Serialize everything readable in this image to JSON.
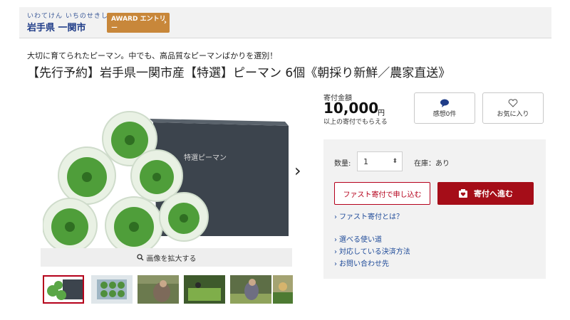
{
  "header": {
    "kana": "いわてけん いちのせきし",
    "city": "岩手県 一関市",
    "award_label": "AWARD エントリー",
    "award_chevron": "›",
    "award_color": "#c8873a"
  },
  "product": {
    "subtitle": "大切に育てられたピーマン。中でも、高品質なピーマンばかりを選別！",
    "title": "【先行予約】岩手県一関市産【特選】ピーマン 6個《朝採り新鮮／農家直送》",
    "box_label": "特選ピーマン",
    "zoom_label": "画像を拡大する",
    "next_arrow": "›"
  },
  "price": {
    "label": "寄付金額",
    "amount": "10,000",
    "unit": "円",
    "note": "以上の寄付でもらえる"
  },
  "actions": {
    "review_label": "感想0件",
    "review_icon": "speech-bubble-icon",
    "favorite_label": "お気に入り",
    "favorite_icon": "heart-icon"
  },
  "order": {
    "qty_label": "数量:",
    "qty_value": "1",
    "stock_label": "在庫：あり",
    "fast_label": "ファスト寄付で申し込む",
    "donate_label": "寄付へ進む",
    "donate_color": "#a50d18",
    "fast_about": "ファスト寄付とは？",
    "links": [
      "選べる使い道",
      "対応している決済方法",
      "お問い合わせ先"
    ]
  }
}
